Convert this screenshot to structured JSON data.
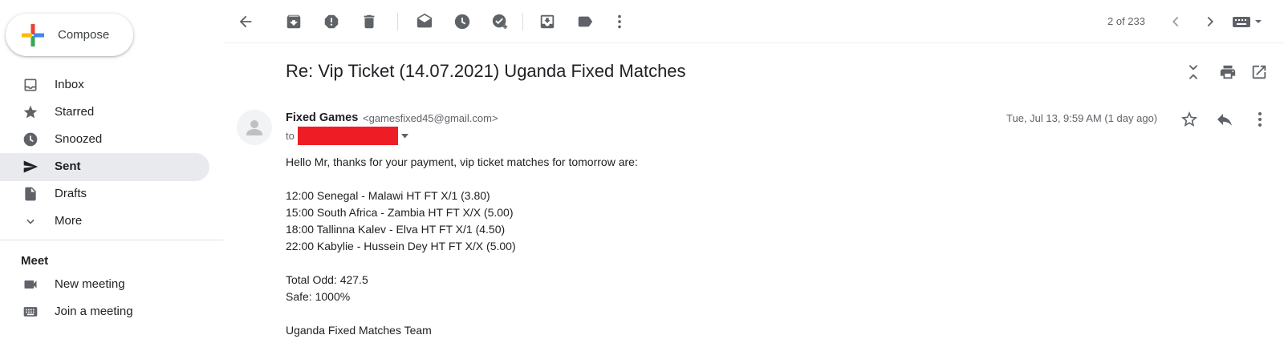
{
  "compose": {
    "label": "Compose"
  },
  "nav": [
    {
      "id": "inbox",
      "label": "Inbox",
      "icon": "inbox-icon"
    },
    {
      "id": "starred",
      "label": "Starred",
      "icon": "star-icon"
    },
    {
      "id": "snoozed",
      "label": "Snoozed",
      "icon": "clock-icon"
    },
    {
      "id": "sent",
      "label": "Sent",
      "icon": "send-icon",
      "active": true
    },
    {
      "id": "drafts",
      "label": "Drafts",
      "icon": "draft-icon"
    },
    {
      "id": "more",
      "label": "More",
      "icon": "chevron-down-icon"
    }
  ],
  "meet": {
    "title": "Meet",
    "items": [
      {
        "label": "New meeting",
        "icon": "videocam-icon"
      },
      {
        "label": "Join a meeting",
        "icon": "keyboard-icon"
      }
    ]
  },
  "toolbar": {
    "pager": "2 of 233"
  },
  "email": {
    "subject": "Re: Vip Ticket (14.07.2021) Uganda Fixed Matches",
    "sender_name": "Fixed Games",
    "sender_email": "<gamesfixed45@gmail.com>",
    "to_label": "to",
    "date": "Tue, Jul 13, 9:59 AM (1 day ago)",
    "body": {
      "greeting": "Hello Mr, thanks for your payment, vip ticket matches for tomorrow are:",
      "matches": [
        "12:00 Senegal - Malawi HT FT X/1 (3.80)",
        "15:00 South Africa - Zambia HT FT X/X (5.00)",
        "18:00 Tallinna Kalev - Elva HT FT X/1 (4.50)",
        "22:00 Kabylie - Hussein Dey HT FT X/X (5.00)"
      ],
      "total_odd": "Total Odd: 427.5",
      "safe": "Safe: 1000%",
      "signature": "Uganda Fixed Matches Team"
    }
  },
  "colors": {
    "redaction": "#ee1c25",
    "active_nav_bg": "#e8eaed",
    "icon_gray": "#5f6368"
  }
}
